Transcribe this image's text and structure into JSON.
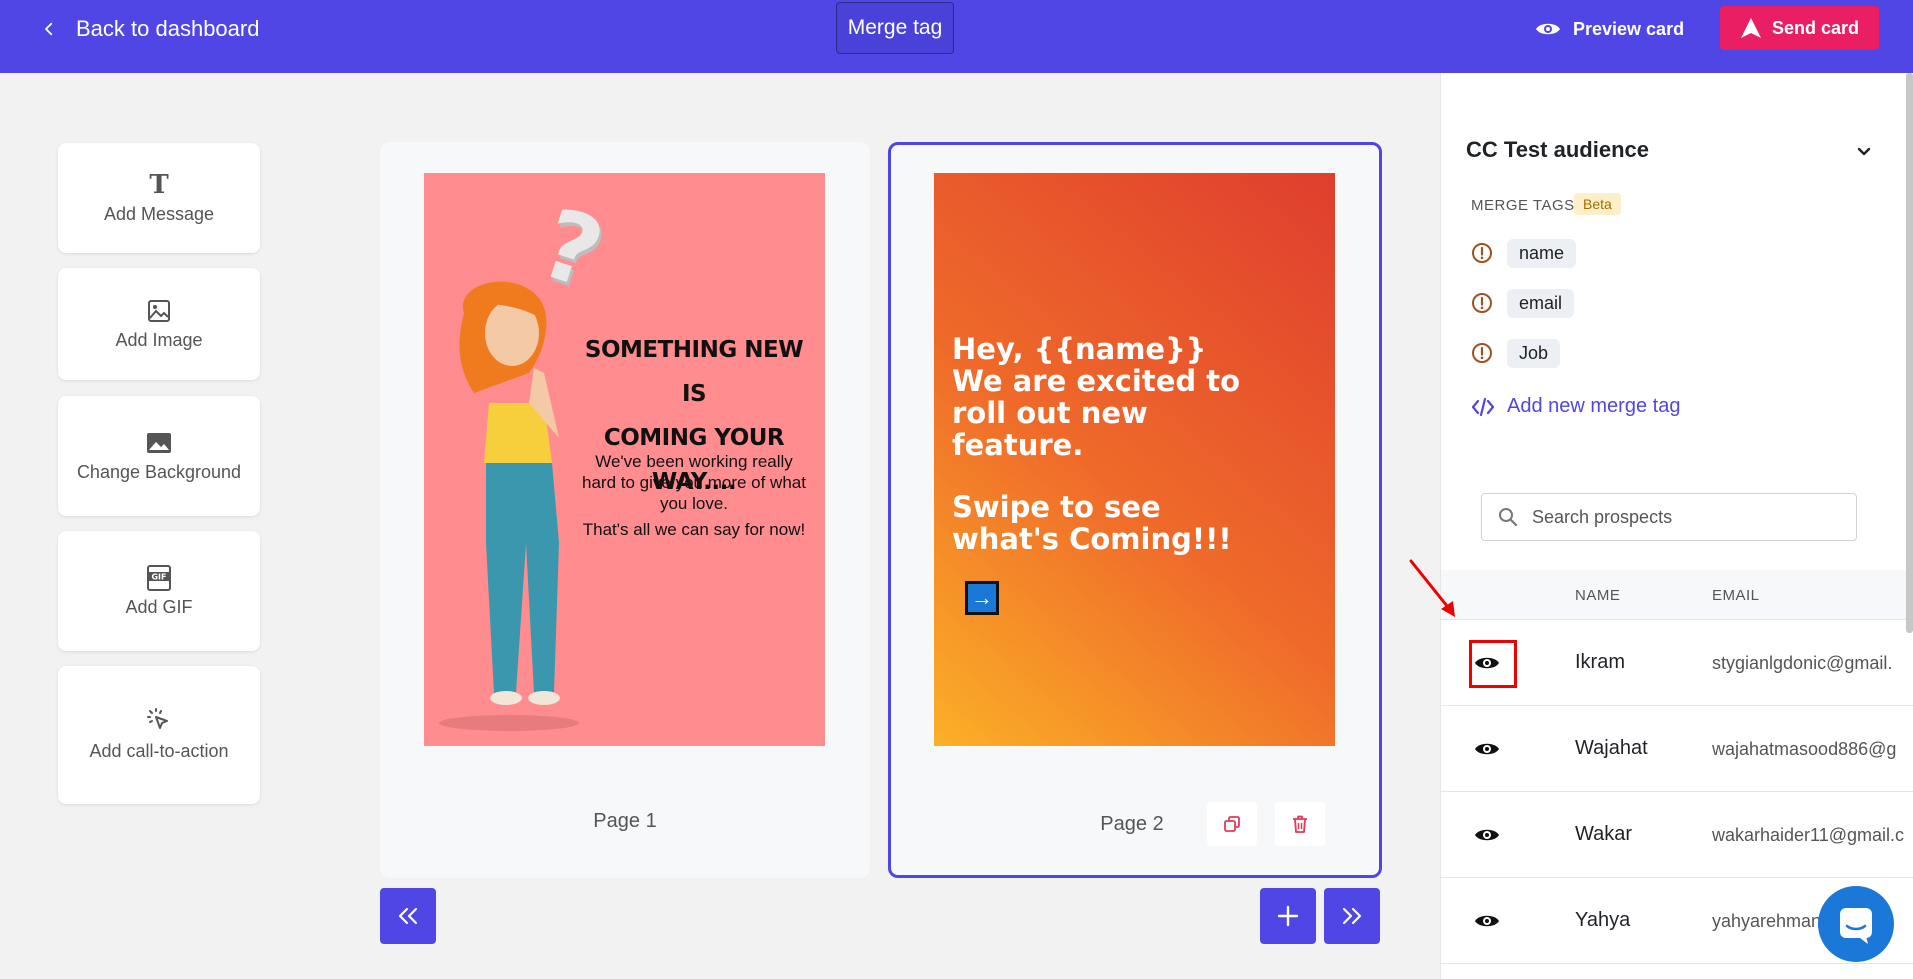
{
  "topbar": {
    "back_label": "Back to dashboard",
    "merge_tag_label": "Merge tag",
    "preview_label": "Preview card",
    "send_label": "Send card"
  },
  "tools": [
    {
      "label": "Add Message",
      "icon": "text-icon"
    },
    {
      "label": "Add Image",
      "icon": "image-icon"
    },
    {
      "label": "Change Background",
      "icon": "background-icon"
    },
    {
      "label": "Add GIF",
      "icon": "gif-icon"
    },
    {
      "label": "Add call-to-action",
      "icon": "cursor-click-icon"
    }
  ],
  "pages": [
    {
      "label": "Page 1",
      "headline_1": "SOMETHING NEW IS",
      "headline_2": "COMING YOUR WAY....",
      "body": "We've been working really hard to give you more of what you love.",
      "body_2": "That's all we can say for now!"
    },
    {
      "label": "Page 2",
      "text_line_1": "Hey, {{name}}",
      "text_line_2": "We are excited to",
      "text_line_3": "roll out new",
      "text_line_4": "feature.",
      "text_line_5": "Swipe to see",
      "text_line_6": "what's Coming!!!",
      "arrow": "→"
    }
  ],
  "panel": {
    "audience_title": "CC Test audience",
    "merge_tags_label": "MERGE TAGS",
    "beta_label": "Beta",
    "merge_tags": [
      "name",
      "email",
      "Job"
    ],
    "add_merge_tag_label": "Add new merge tag",
    "search_placeholder": "Search prospects",
    "columns": {
      "name": "NAME",
      "email": "EMAIL"
    },
    "prospects": [
      {
        "name": "Ikram",
        "email": "stygianlgdonic@gmail."
      },
      {
        "name": "Wajahat",
        "email": "wajahatmasood886@g"
      },
      {
        "name": "Wakar",
        "email": "wakarhaider11@gmail.c"
      },
      {
        "name": "Yahya",
        "email": "yahyarehman"
      }
    ]
  },
  "colors": {
    "brand": "#4f46e5",
    "send": "#e91e63",
    "page1_bg": "#ff8c8e",
    "highlight": "#ee0000"
  }
}
